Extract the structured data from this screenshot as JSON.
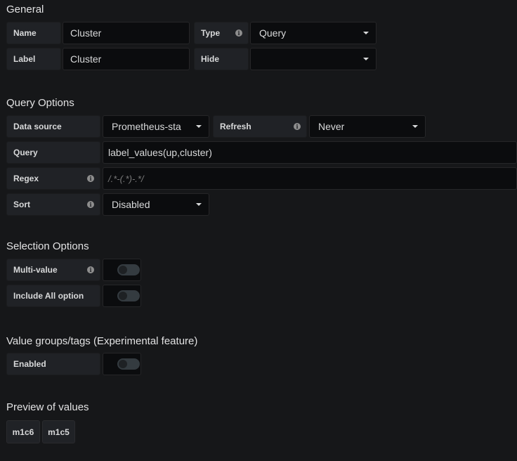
{
  "general": {
    "title": "General",
    "name_label": "Name",
    "name_value": "Cluster",
    "type_label": "Type",
    "type_value": "Query",
    "label_label": "Label",
    "label_value": "Cluster",
    "hide_label": "Hide",
    "hide_value": ""
  },
  "query_options": {
    "title": "Query Options",
    "datasource_label": "Data source",
    "datasource_value": "Prometheus-sta",
    "refresh_label": "Refresh",
    "refresh_value": "Never",
    "query_label": "Query",
    "query_value": "label_values(up,cluster)",
    "regex_label": "Regex",
    "regex_placeholder": "/.*-(.*)-.*/",
    "sort_label": "Sort",
    "sort_value": "Disabled"
  },
  "selection_options": {
    "title": "Selection Options",
    "multi_value_label": "Multi-value",
    "multi_value_on": false,
    "include_all_label": "Include All option",
    "include_all_on": false
  },
  "value_groups": {
    "title": "Value groups/tags (Experimental feature)",
    "enabled_label": "Enabled",
    "enabled_on": false
  },
  "preview": {
    "title": "Preview of values",
    "values": [
      "m1c6",
      "m1c5"
    ]
  },
  "icons": {
    "info": "info-icon",
    "caret": "caret-down-icon"
  }
}
